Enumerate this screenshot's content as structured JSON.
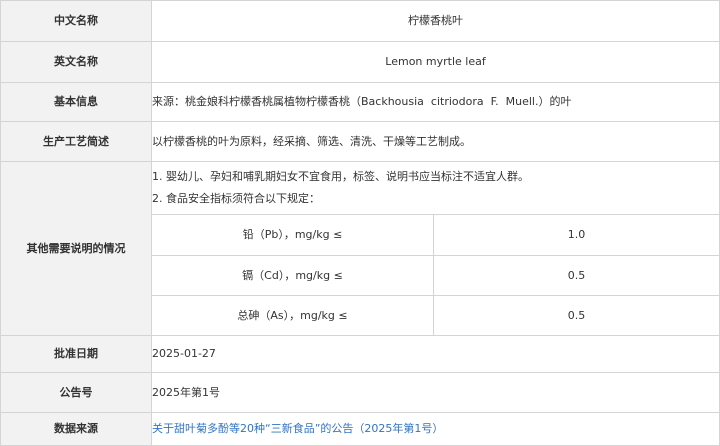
{
  "rows": {
    "chinese_name": {
      "label": "中文名称",
      "value": "柠檬香桃叶"
    },
    "english_name": {
      "label": "英文名称",
      "value": "Lemon myrtle leaf"
    },
    "basic_info": {
      "label": "基本信息",
      "value": "来源：桃金娘科柠檬香桃属植物柠檬香桃（Backhousia  citriodora  F.  Muell.）的叶"
    },
    "process": {
      "label": "生产工艺简述",
      "value": "以柠檬香桃的叶为原料，经采摘、筛选、清洗、干燥等工艺制成。"
    },
    "other_notes": {
      "label": "其他需要说明的情况",
      "note_1": "1. 婴幼儿、孕妇和哺乳期妇女不宜食用，标签、说明书应当标注不适宜人群。",
      "note_2": "2. 食品安全指标须符合以下规定：",
      "limits": [
        {
          "name": "铅（Pb），mg/kg ≤",
          "value": "1.0"
        },
        {
          "name": "镉（Cd），mg/kg ≤",
          "value": "0.5"
        },
        {
          "name": "总砷（As），mg/kg ≤",
          "value": "0.5"
        }
      ]
    },
    "approval_date": {
      "label": "批准日期",
      "value": "2025-01-27"
    },
    "announcement_no": {
      "label": "公告号",
      "value": "2025年第1号"
    },
    "data_source": {
      "label": "数据来源",
      "value": "关于甜叶菊多酚等20种“三新食品”的公告（2025年第1号）"
    }
  },
  "colors": {
    "label_bg": "#f2f2f2",
    "border": "#d4d4d4",
    "text": "#333333",
    "link": "#2f74c8"
  }
}
